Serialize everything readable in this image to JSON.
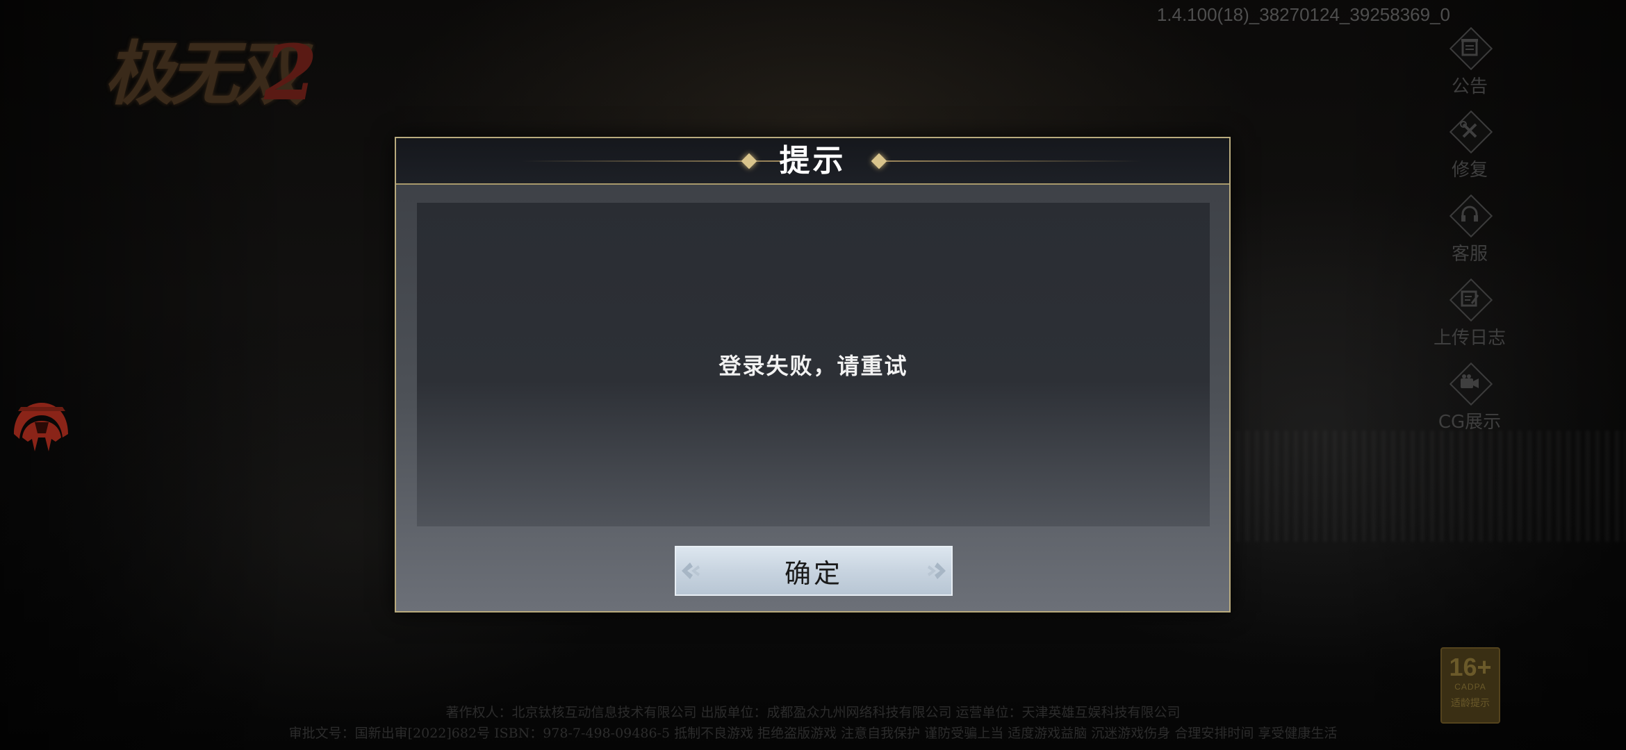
{
  "app": {
    "logo_text": "极无双",
    "logo_number": "2",
    "version": "1.4.100(18)_38270124_39258369_0"
  },
  "side_menu": {
    "items": [
      {
        "label": "公告",
        "icon": "notice-icon"
      },
      {
        "label": "修复",
        "icon": "repair-icon"
      },
      {
        "label": "客服",
        "icon": "headset-icon"
      },
      {
        "label": "上传日志",
        "icon": "upload-log-icon"
      },
      {
        "label": "CG展示",
        "icon": "video-camera-icon"
      }
    ]
  },
  "dialog": {
    "title": "提示",
    "message": "登录失败，请重试",
    "confirm_label": "确定"
  },
  "age_rating": {
    "number": "16+",
    "org": "CADPA",
    "tip": "适龄提示"
  },
  "footer": {
    "line1": "著作权人：北京钛核互动信息技术有限公司  出版单位：成都盈众九州网络科技有限公司   运营单位：天津英雄互娱科技有限公司",
    "line2": "审批文号：国新出审[2022]682号 ISBN：978-7-498-09486-5    抵制不良游戏 拒绝盗版游戏 注意自我保护 谨防受骗上当 适度游戏益脑 沉迷游戏伤身 合理安排时间 享受健康生活"
  },
  "colors": {
    "dialog_border": "#b9ab7e",
    "accent_gold": "#d9c48c",
    "helmet_red": "#8a2418"
  }
}
